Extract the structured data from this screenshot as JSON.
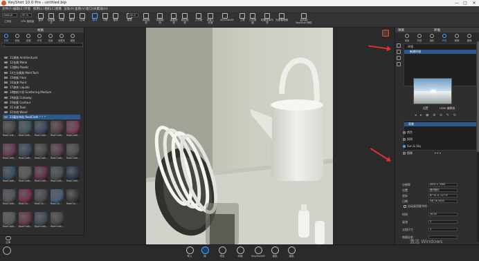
{
  "window": {
    "title": "KeyShot 10.0 Pro - untitled.bip"
  },
  "menu": [
    "文件(F)",
    "编辑(E)",
    "环境",
    "照明(L)",
    "相机(C)",
    "图像",
    "渲染(R)",
    "查看(V)",
    "窗口(W)",
    "帮助(H)"
  ],
  "toolbar": {
    "workspace_select": "Default",
    "items": [
      "工作区",
      "CPU 使用量",
      "暂停",
      "性能模式",
      "去噪",
      "翻译",
      "区域",
      "翻译",
      "平移",
      "推移",
      "视角",
      "添加相机",
      "切换相机",
      "重置相机",
      "锁定相机",
      "工作室",
      "动画工作室",
      "KeyShotXR",
      "工具",
      "几何视图",
      "配置程序向导",
      "光源管理器",
      "启动到 KeyShot 网络"
    ],
    "cpu_value": "95 %",
    "fov_value": "50.0"
  },
  "left_panel": {
    "header": "材质",
    "tabs": [
      "材质",
      "颜色",
      "纹理",
      "环境",
      "背景",
      "收藏夹",
      "模型"
    ],
    "tree": [
      "11建筑 Architectural",
      "12金属 Metal",
      "13塑料 Plastic",
      "14工业模具 Mold-Tech",
      "15地板 Floor",
      "16油漆 Paint",
      "17液体 Liquids",
      "18散射介质 Scattering Medium",
      "19剖面 Cutaway",
      "20轮廓 Contour",
      "21卡通 Toon",
      "22木材 Wood",
      "23真实布料 RealCloth"
    ],
    "selected_index": 12,
    "swatch_labels": [
      "RealCloth...",
      "RealCloth...",
      "RealCloth...",
      "RealCloth...",
      "RealCloth...",
      "RealCloth...",
      "RealCloth...",
      "RealCloth...",
      "RealCloth...",
      "RealCloth...",
      "RealCloth...",
      "RealCloth...",
      "RealCloth...",
      "RealCloth...",
      "RealCloth...",
      "RealCloth...",
      "RealClo...",
      "RealClo...",
      "RealClo...",
      "RealClo...",
      "RealCloth...",
      "RealCloth...",
      "RealCloth...",
      "RealCloth..."
    ],
    "swatch_colors": [
      "#4a4a4a",
      "#3e5a5e",
      "#3a4a60",
      "#5a3e4a",
      "#7a3a5a",
      "#6a3a5a",
      "#3e4a5e",
      "#4a4a4a",
      "#5a3e4e",
      "#4e4e4e",
      "#3a4e5e",
      "#5a5a5a",
      "#6a3050",
      "#4a5058",
      "#2f3a4e",
      "#52525a",
      "#7a3052",
      "#4a4a52",
      "#4a5e7a",
      "#3a3a3a",
      "#585858",
      "#6a3a48",
      "#3e4e5e",
      "#4a4a4a"
    ],
    "footer_label": "云库"
  },
  "right_panel": {
    "header_left": "项目",
    "header_right": "环境",
    "tabs": [
      "场景",
      "材质",
      "相机",
      "环境",
      "照明",
      "图像"
    ],
    "env_list": [
      {
        "label": "环境",
        "selected": false
      },
      {
        "label": "新建环境",
        "selected": true
      }
    ],
    "preview_links": [
      "设置",
      "HDRI 编辑器"
    ],
    "bg_list": [
      {
        "label": "背景",
        "selected": true
      }
    ],
    "bg_options": [
      "颜色",
      "照明",
      "Sun & Sky",
      "图像"
    ],
    "bg_selected": 2,
    "props": [
      {
        "label": "分辨率",
        "value": "4000 × 2000"
      },
      {
        "label": "位置",
        "value": "纽约纽约"
      },
      {
        "label": "坐标",
        "value": "N° 41.9, 117.5°"
      },
      {
        "label": "日期",
        "value": "5月 16 2020"
      }
    ],
    "checkbox_label": "自动采用夏令时",
    "more_props": [
      {
        "label": "时间",
        "value": "10:54"
      },
      {
        "label": "混浊",
        "value": "3"
      },
      {
        "label": "太阳尺寸",
        "value": "1"
      },
      {
        "label": "地面反射",
        "value": ""
      }
    ]
  },
  "bottom_bar": {
    "items": [
      "导入",
      "库",
      "项目",
      "动画",
      "KeyShotXR",
      "渲染",
      "渲染"
    ],
    "active_index": 1
  },
  "watermark": {
    "line1": "激活 Windows",
    "line2": "转到\"设置\"以激活 Windows。"
  }
}
